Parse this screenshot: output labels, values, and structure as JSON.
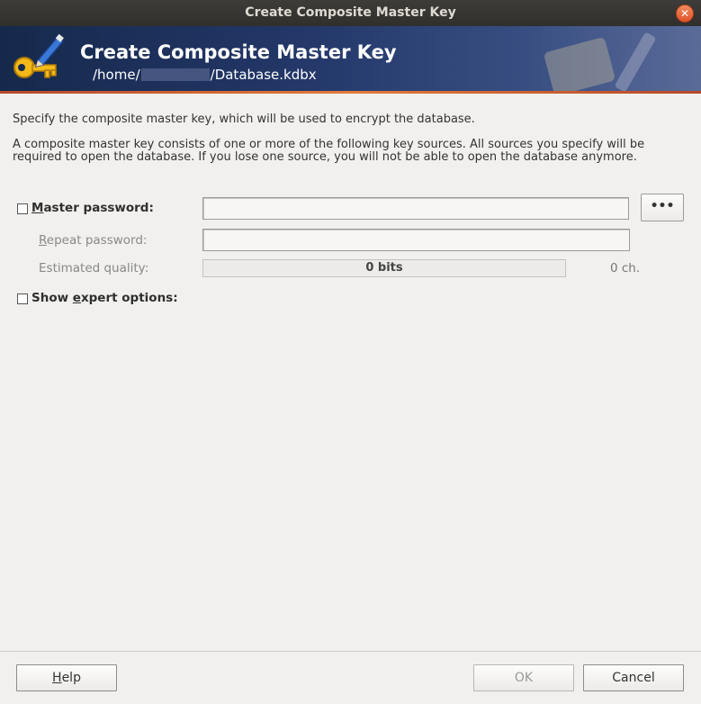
{
  "window": {
    "title": "Create Composite Master Key",
    "close_glyph": "✕"
  },
  "banner": {
    "title": "Create Composite Master Key",
    "path_prefix": "/home/",
    "path_suffix": "/Database.kdbx"
  },
  "description": {
    "line1": "Specify the composite master key, which will be used to encrypt the database.",
    "line2": "A composite master key consists of one or more of the following key sources. All sources you specify will be",
    "line3": "required to open the database. If you lose one source, you will not be able to open the database anymore."
  },
  "password": {
    "label_accel": "M",
    "label_rest": "aster password:",
    "checked": false,
    "value": "",
    "toggle_button": "•••"
  },
  "repeat": {
    "label_accel": "R",
    "label_rest": "epeat password:",
    "value": ""
  },
  "quality": {
    "label": "Estimated quality:",
    "bits": "0 bits",
    "chars": "0 ch.",
    "level": 0
  },
  "expert": {
    "label_pre": "Show ",
    "label_accel": "e",
    "label_rest": "xpert options:",
    "checked": false
  },
  "footer": {
    "help_accel": "H",
    "help_rest": "elp",
    "ok": "OK",
    "cancel": "Cancel"
  },
  "colors": {
    "banner_start": "#16294c",
    "banner_end": "#5a6b98",
    "accent": "#e07c3c"
  }
}
